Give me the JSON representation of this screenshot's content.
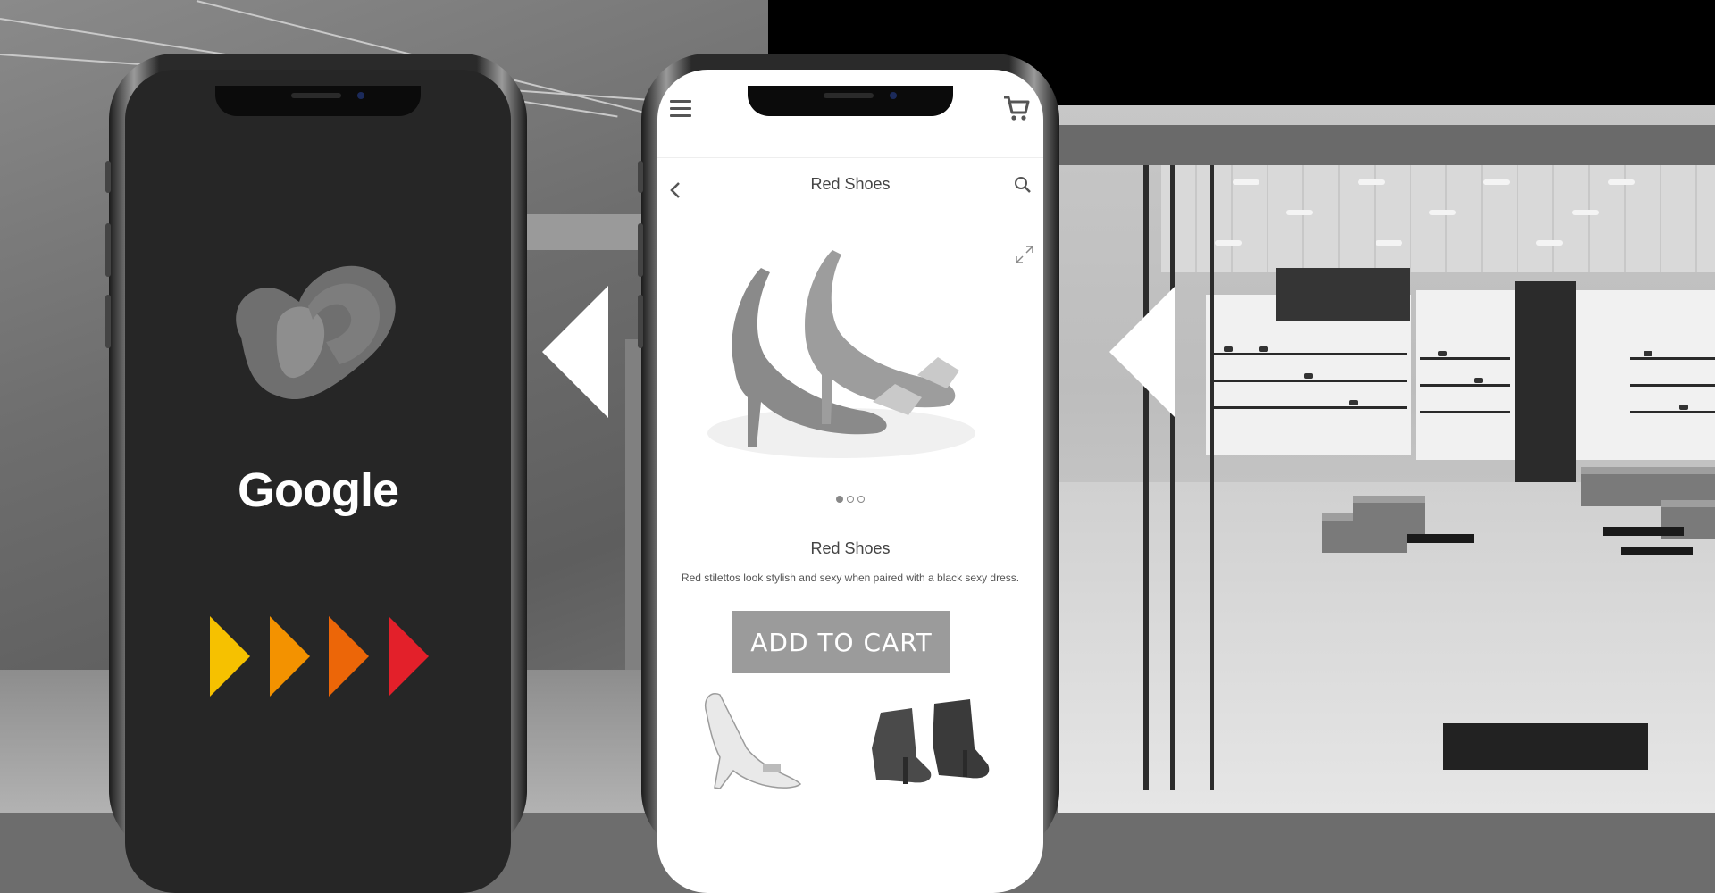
{
  "google_wordmark": "Google",
  "store_app": {
    "page_title": "Red Shoes",
    "product": {
      "name": "Red Shoes",
      "description": "Red stilettos look stylish and sexy when paired with a black sexy dress.",
      "add_to_cart_label": "ADD TO CART"
    },
    "carousel": {
      "total": 3,
      "active": 1
    },
    "icons": [
      "hamburger-menu-icon",
      "shopping-cart-icon",
      "back-arrow-icon",
      "search-icon",
      "expand-icon"
    ]
  },
  "chevron_colors": [
    "#f6c100",
    "#f39200",
    "#ec6608",
    "#e3202a"
  ],
  "colors": {
    "button": "#9b9b9b",
    "screen_dark": "#262626"
  }
}
